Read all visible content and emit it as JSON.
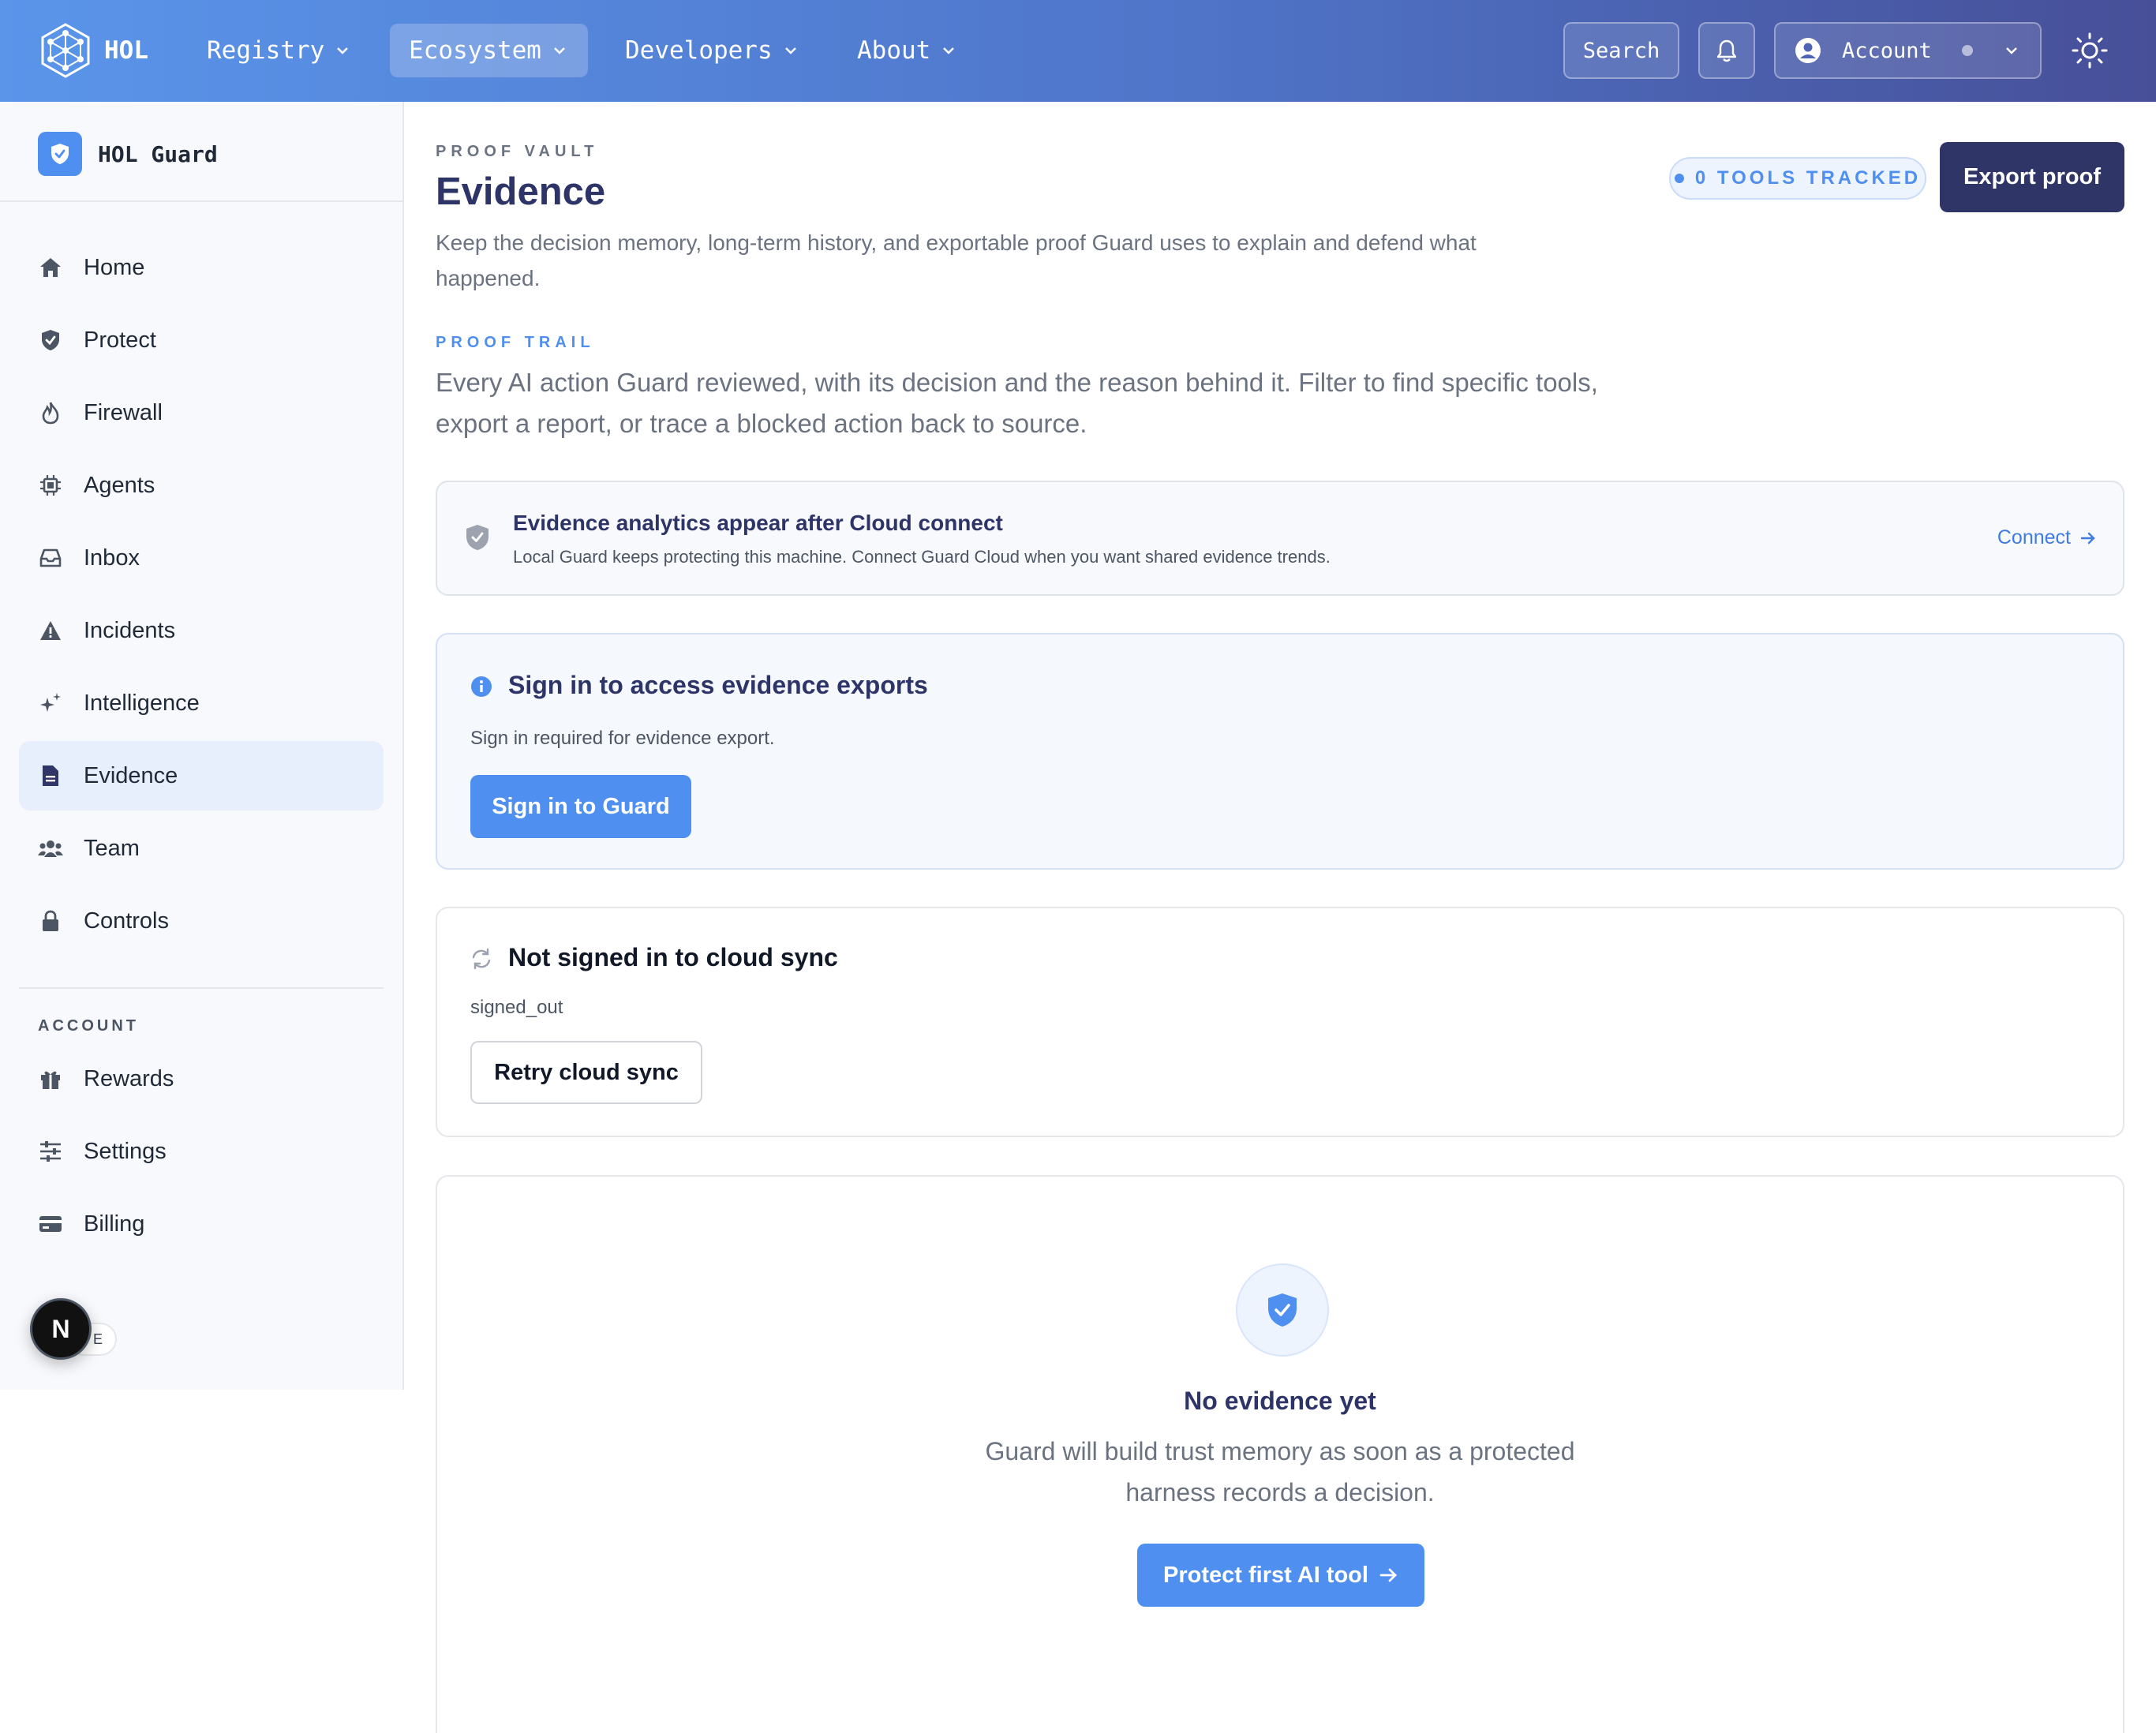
{
  "topbar": {
    "brand": "HOL",
    "nav": [
      {
        "label": "Registry"
      },
      {
        "label": "Ecosystem"
      },
      {
        "label": "Developers"
      },
      {
        "label": "About"
      }
    ],
    "search_label": "Search",
    "account_label": "Account",
    "icons": [
      "hexagon-network-logo",
      "bell-icon",
      "user-circle-icon",
      "status-dot",
      "chevron-down-icon",
      "sun-icon"
    ]
  },
  "sidebar": {
    "brand": "HOL Guard",
    "items": [
      {
        "label": "Home",
        "icon": "home-icon"
      },
      {
        "label": "Protect",
        "icon": "shield-check-icon"
      },
      {
        "label": "Firewall",
        "icon": "flame-icon"
      },
      {
        "label": "Agents",
        "icon": "cpu-icon"
      },
      {
        "label": "Inbox",
        "icon": "inbox-icon"
      },
      {
        "label": "Incidents",
        "icon": "warning-icon"
      },
      {
        "label": "Intelligence",
        "icon": "sparkles-icon"
      },
      {
        "label": "Evidence",
        "icon": "document-icon",
        "active": true
      },
      {
        "label": "Team",
        "icon": "users-icon"
      },
      {
        "label": "Controls",
        "icon": "lock-icon"
      }
    ],
    "account_section": "ACCOUNT",
    "account_items": [
      {
        "label": "Rewards",
        "icon": "gift-icon"
      },
      {
        "label": "Settings",
        "icon": "sliders-icon"
      },
      {
        "label": "Billing",
        "icon": "credit-card-icon"
      }
    ],
    "dev_badge": "N",
    "dev_pill": "E"
  },
  "main": {
    "eyebrow": "PROOF VAULT",
    "title": "Evidence",
    "subtitle": "Keep the decision memory, long-term history, and exportable proof Guard uses to explain and defend what happened.",
    "tools_tracked": "0 TOOLS TRACKED",
    "export_label": "Export proof",
    "trail_eyebrow": "PROOF TRAIL",
    "trail_text": "Every AI action Guard reviewed, with its decision and the reason behind it. Filter to find specific tools, export a report, or trace a blocked action back to source.",
    "analytics": {
      "title": "Evidence analytics appear after Cloud connect",
      "body": "Local Guard keeps protecting this machine. Connect Guard Cloud when you want shared evidence trends.",
      "link": "Connect"
    },
    "signin": {
      "title": "Sign in to access evidence exports",
      "body": "Sign in required for evidence export.",
      "button": "Sign in to Guard"
    },
    "sync": {
      "title": "Not signed in to cloud sync",
      "status": "signed_out",
      "button": "Retry cloud sync"
    },
    "empty": {
      "title": "No evidence yet",
      "body": "Guard will build trust memory as soon as a protected harness records a decision.",
      "button": "Protect first AI tool"
    }
  },
  "colors": {
    "accent": "#4f8ff0",
    "navy": "#2f3566",
    "title": "#2d3467",
    "muted": "#6b7280"
  }
}
